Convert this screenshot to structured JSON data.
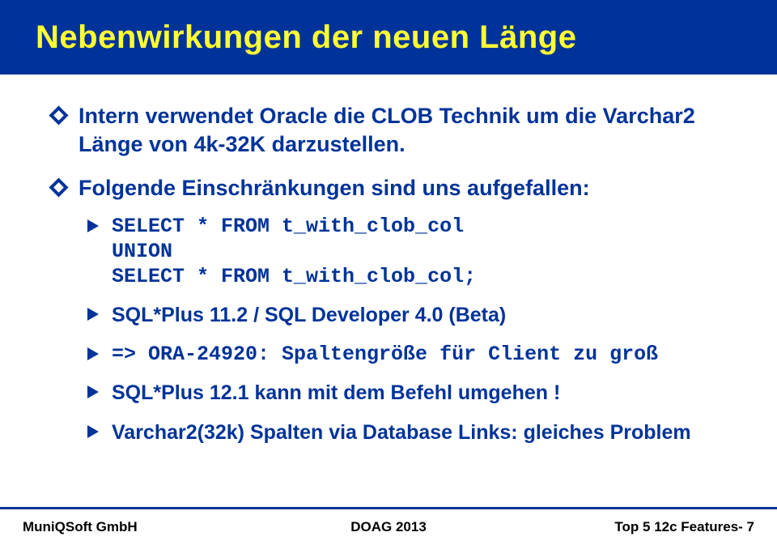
{
  "title": "Nebenwirkungen der neuen Länge",
  "bullets": {
    "b1": "Intern verwendet Oracle die CLOB Technik um die Varchar2 Länge von 4k-32K darzustellen.",
    "b2": "Folgende Einschränkungen sind uns aufgefallen:",
    "code1": "SELECT * FROM t_with_clob_col\nUNION\nSELECT * FROM t_with_clob_col;",
    "s1": "SQL*Plus 11.2 / SQL Developer 4.0 (Beta)",
    "code2": "=> ORA-24920: Spaltengröße für Client zu groß",
    "s2": "SQL*Plus 12.1 kann mit dem Befehl umgehen !",
    "s3": "Varchar2(32k) Spalten via Database Links: gleiches Problem"
  },
  "footer": {
    "left": "MuniQSoft GmbH",
    "center": "DOAG 2013",
    "right": "Top 5 12c Features- 7"
  }
}
